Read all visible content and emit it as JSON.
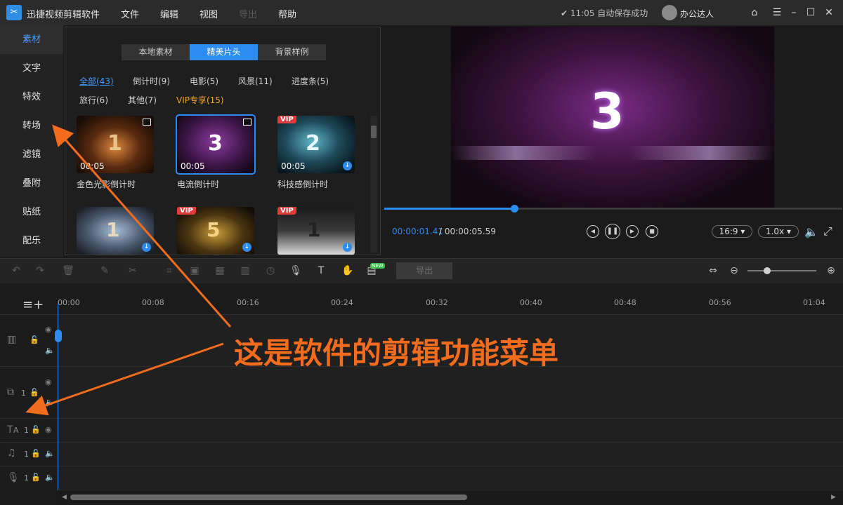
{
  "app": {
    "title": "迅捷视频剪辑软件",
    "logo": "scissors-icon"
  },
  "menu": {
    "file": "文件",
    "edit": "编辑",
    "view": "视图",
    "export": "导出",
    "help": "帮助"
  },
  "status": {
    "autosave": "✔ 11:05 自动保存成功",
    "user": "办公达人"
  },
  "nav": [
    "素材",
    "文字",
    "特效",
    "转场",
    "滤镜",
    "叠附",
    "贴纸",
    "配乐"
  ],
  "library": {
    "tabs": [
      "本地素材",
      "精美片头",
      "背景样例"
    ],
    "filters": [
      "全部(43)",
      "倒计时(9)",
      "电影(5)",
      "风景(11)",
      "进度条(5)",
      "旅行(6)",
      "其他(7)",
      "VIP专享(15)"
    ],
    "items": [
      {
        "name": "金色光影倒计时",
        "duration": "00:05",
        "digit": "1"
      },
      {
        "name": "电流倒计时",
        "duration": "00:05",
        "digit": "3"
      },
      {
        "name": "科技感倒计时",
        "duration": "00:05",
        "digit": "2",
        "vip": "VIP"
      },
      {
        "name": "",
        "duration": "",
        "digit": "1"
      },
      {
        "name": "",
        "duration": "",
        "digit": "5",
        "vip": "VIP"
      },
      {
        "name": "",
        "duration": "",
        "digit": "1",
        "vip": "VIP"
      }
    ]
  },
  "preview": {
    "digit": "3",
    "progress": 0.283,
    "time_current": "00:00:01.41",
    "time_total": "/ 00:00:05.59",
    "aspect": "16:9 ▾",
    "speed": "1.0x ▾"
  },
  "toolbar": {
    "export": "导出",
    "new_badge": "NEW"
  },
  "timeline": {
    "ticks": [
      "00:00",
      "00:08",
      "00:16",
      "00:24",
      "00:32",
      "00:40",
      "00:48",
      "00:56",
      "01:04"
    ],
    "track_num": "1"
  },
  "annotation": "这是软件的剪辑功能菜单",
  "colors": {
    "accent": "#2d8cf0",
    "annotation": "#f36b1c",
    "vip": "#f0a62b"
  }
}
